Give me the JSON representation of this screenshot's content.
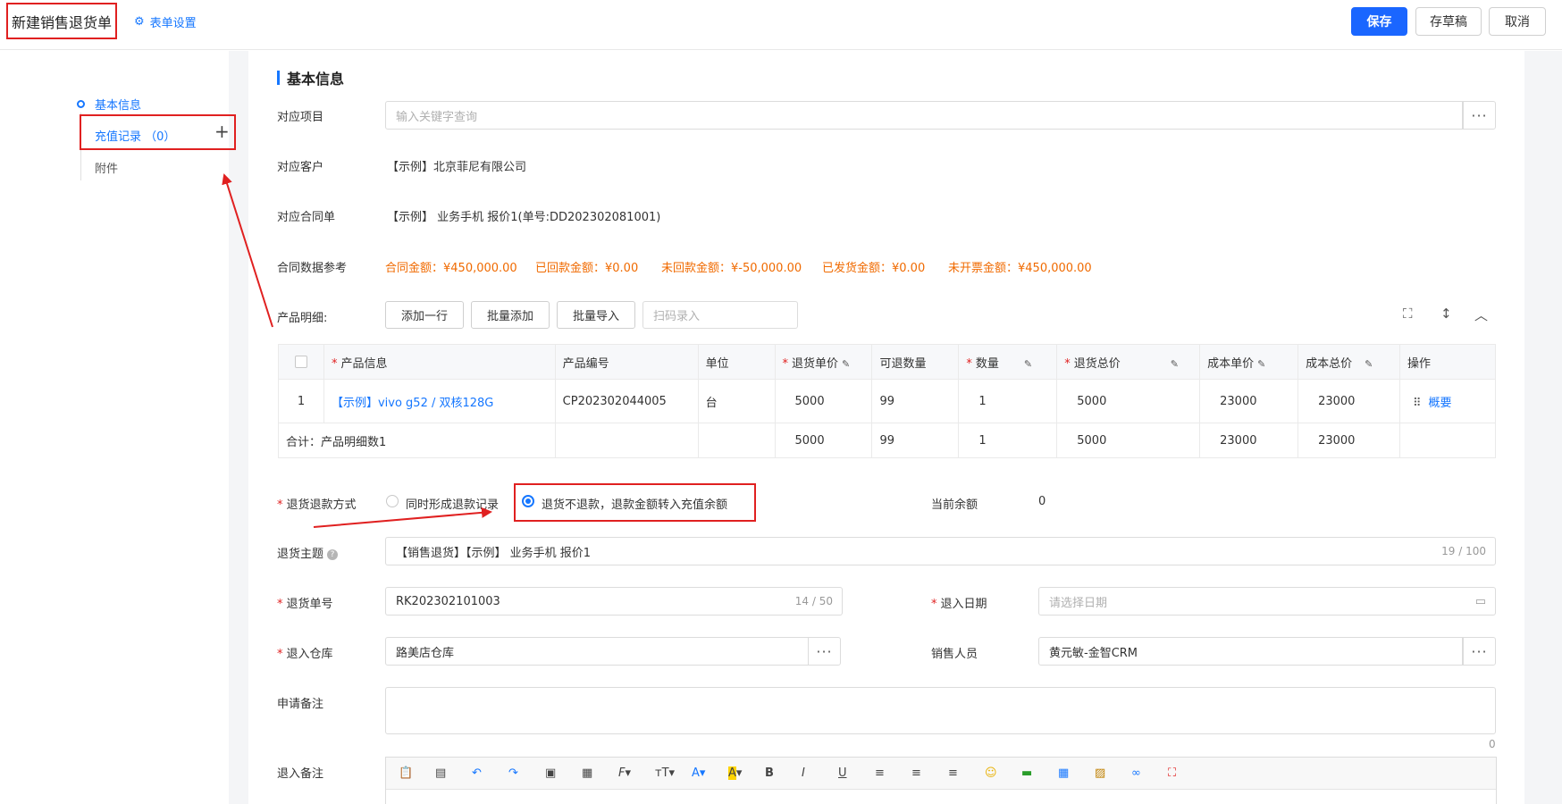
{
  "header": {
    "title": "新建销售退货单",
    "form_settings": "表单设置",
    "save": "保存",
    "draft": "存草稿",
    "cancel": "取消"
  },
  "nav": {
    "basic_info": "基本信息",
    "recharge": "充值记录 （0）",
    "plus": "+",
    "attachments": "附件"
  },
  "section": {
    "title": "基本信息"
  },
  "form": {
    "project_label": "对应项目",
    "project_placeholder": "输入关键字查询",
    "customer_label": "对应客户",
    "customer_value": "【示例】北京菲尼有限公司",
    "contract_label": "对应合同单",
    "contract_value": "【示例】 业务手机 报价1(单号:DD202302081001)",
    "contract_data_label": "合同数据参考",
    "contract_amount": "合同金额：¥450,000.00",
    "received_amount": "已回款金额：¥0.00",
    "unreceived_amount": "未回款金额：¥-50,000.00",
    "shipped_amount": "已发货金额：¥0.00",
    "uninvoiced_amount": "未开票金额：¥450,000.00",
    "product_detail_label": "产品明细:",
    "add_row": "添加一行",
    "batch_add": "批量添加",
    "batch_import": "批量导入",
    "scan_placeholder": "扫码录入",
    "refund_method_label": "退货退款方式",
    "refund_option_1": "同时形成退款记录",
    "refund_option_2": "退货不退款，退款金额转入充值余额",
    "balance_label": "当前余额",
    "balance_value": "0",
    "subject_label": "退货主题",
    "subject_value": "【销售退货】【示例】 业务手机 报价1",
    "subject_counter": "19 / 100",
    "return_no_label": "退货单号",
    "return_no_value": "RK202302101003",
    "return_no_counter": "14 / 50",
    "return_date_label": "退入日期",
    "return_date_placeholder": "请选择日期",
    "warehouse_label": "退入仓库",
    "warehouse_value": "路美店仓库",
    "salesperson_label": "销售人员",
    "salesperson_value": "黄元敏-金智CRM",
    "apply_note_label": "申请备注",
    "apply_note_counter": "0",
    "return_note_label": "退入备注"
  },
  "table": {
    "headers": [
      "产品信息",
      "产品编号",
      "单位",
      "退货单价",
      "可退数量",
      "数量",
      "退货总价",
      "成本单价",
      "成本总价",
      "操作"
    ],
    "row": {
      "index": "1",
      "product": "【示例】vivo g52 / 双核128G",
      "code": "CP202302044005",
      "unit": "台",
      "price": "5000",
      "returnable": "99",
      "qty": "1",
      "total": "5000",
      "cost_price": "23000",
      "cost_total": "23000",
      "action": "概要"
    },
    "summary": {
      "label": "合计：产品明细数1",
      "price": "5000",
      "returnable": "99",
      "qty": "1",
      "total": "5000",
      "cost_price": "23000",
      "cost_total": "23000"
    }
  },
  "editor_tools": [
    "paste-icon",
    "paste-text-icon",
    "undo-icon",
    "redo-icon",
    "paste-word-icon",
    "paste-excel-icon",
    "font-family-icon",
    "font-size-icon",
    "font-color-icon",
    "highlight-icon",
    "bold-icon",
    "italic-icon",
    "underline-icon",
    "align-left-icon",
    "align-center-icon",
    "align-right-icon",
    "emoji-icon",
    "insert-row-icon",
    "table-icon",
    "image-icon",
    "link-icon",
    "fullscreen-icon"
  ],
  "colors": {
    "accent": "#1677ff",
    "primary_button": "#1a66ff",
    "annotation": "#e02020",
    "orange": "#f06a00"
  }
}
